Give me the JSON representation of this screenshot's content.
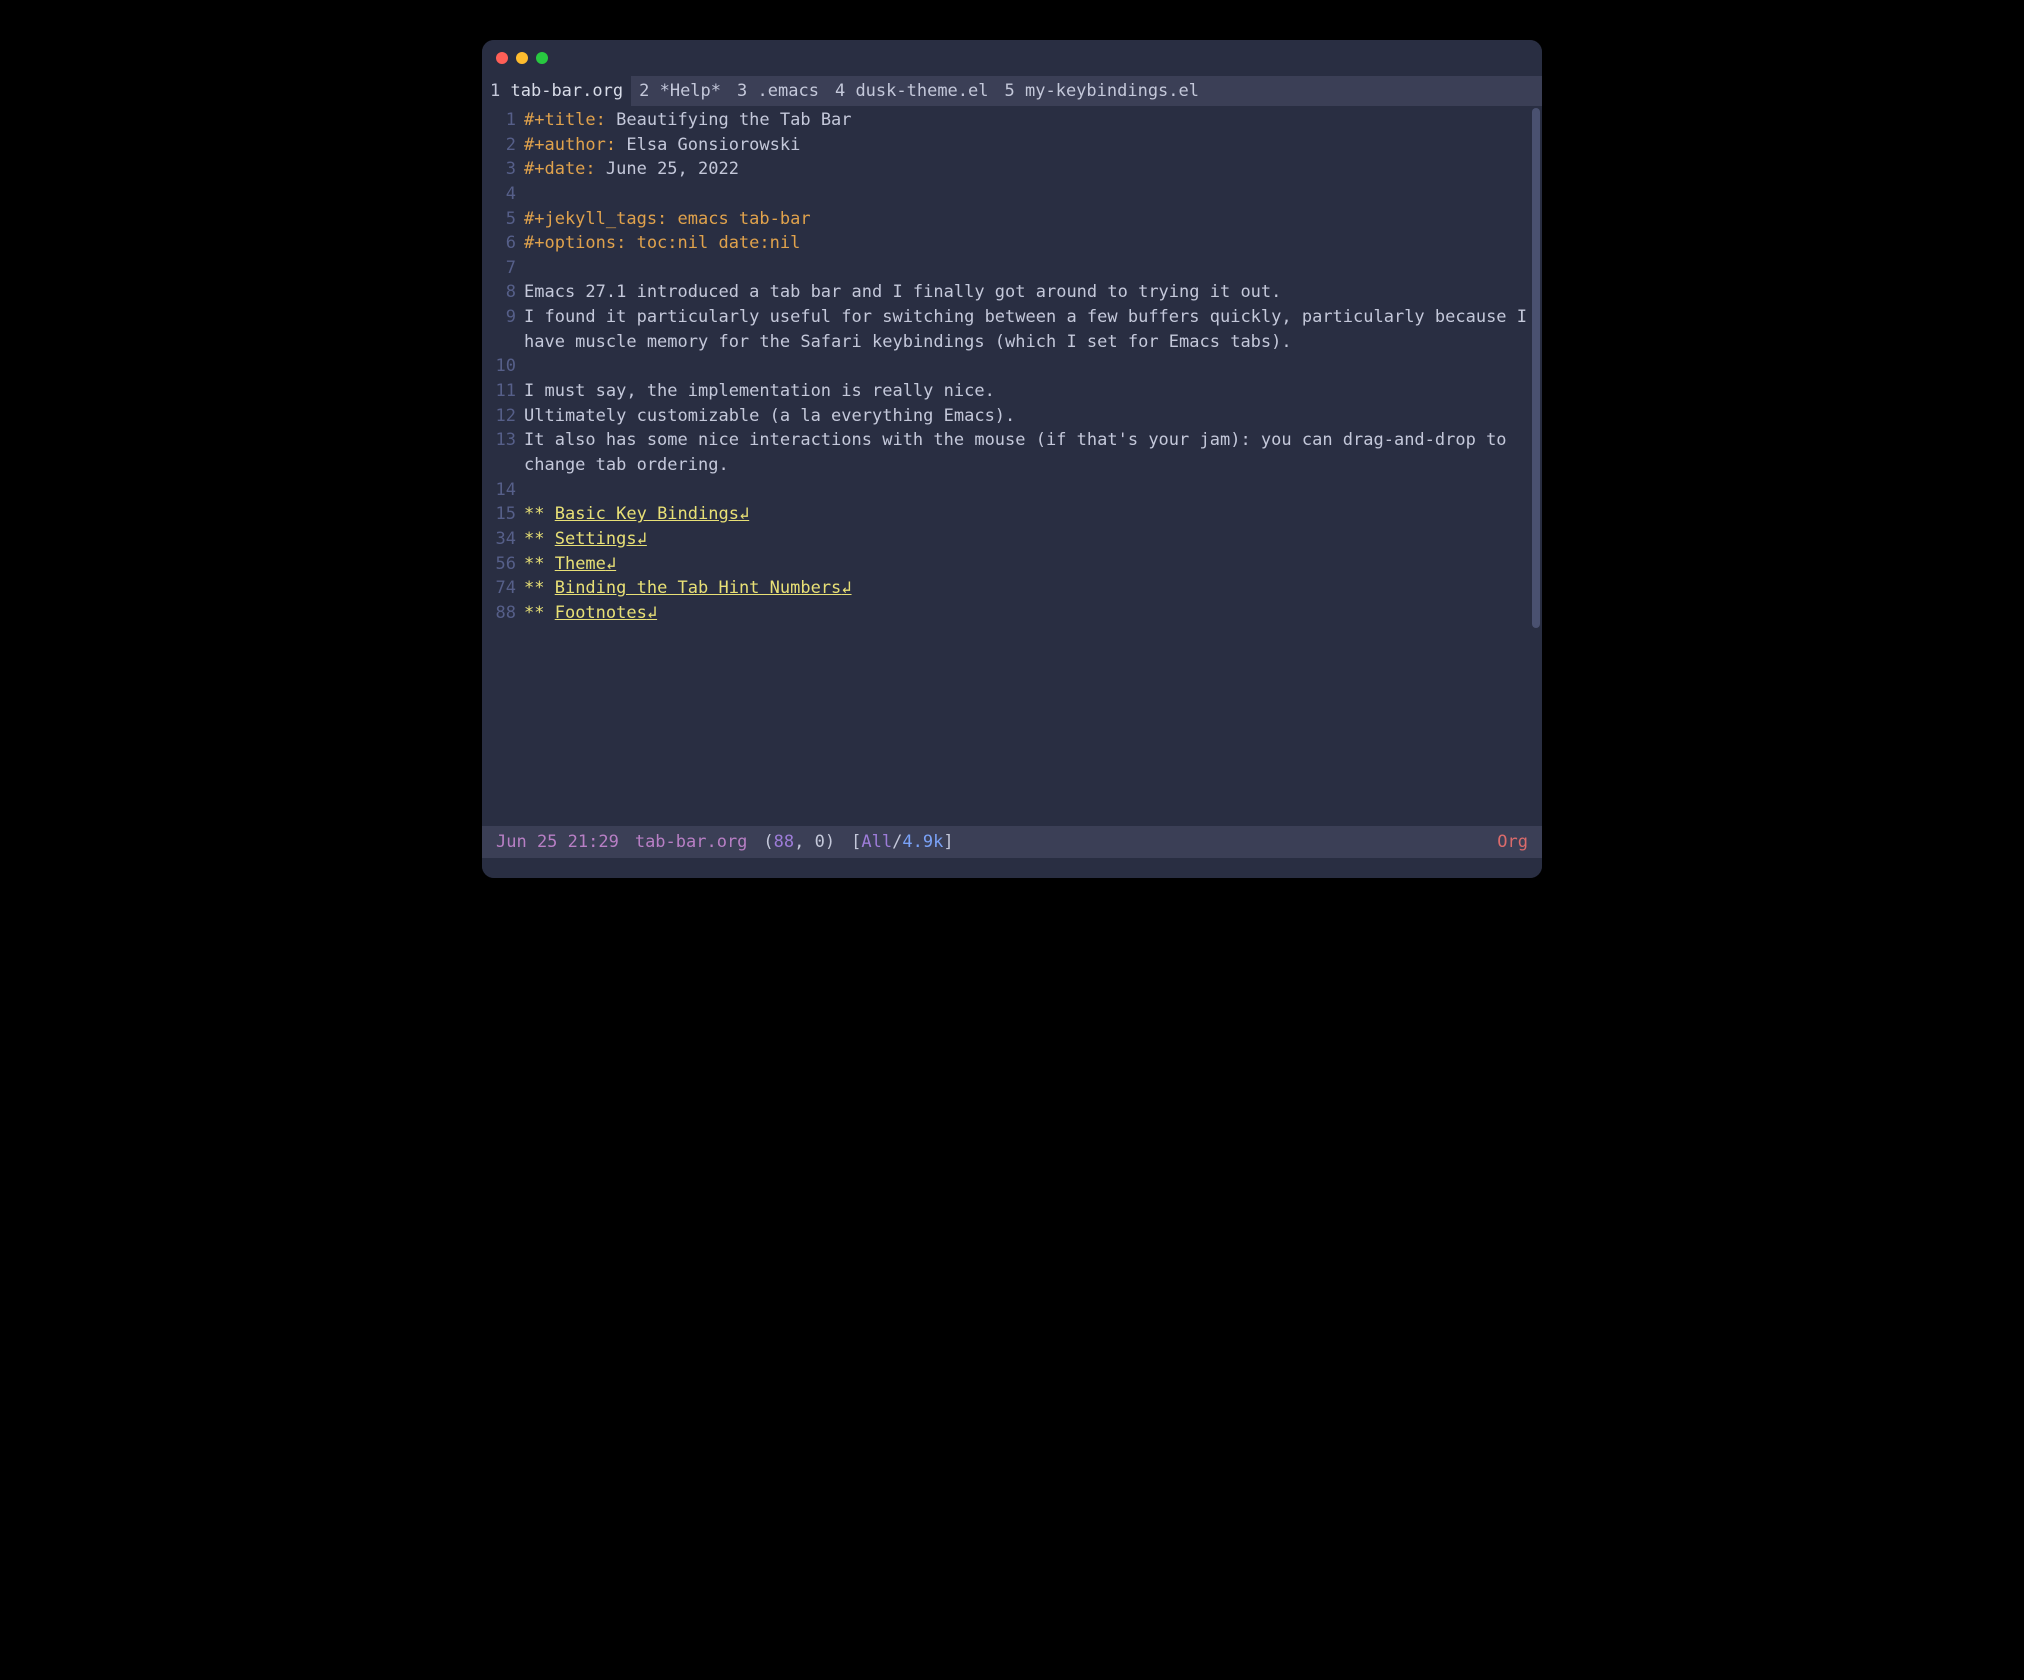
{
  "tabs": [
    {
      "num": "1",
      "label": "tab-bar.org",
      "active": true
    },
    {
      "num": "2",
      "label": "*Help*",
      "active": false
    },
    {
      "num": "3",
      "label": ".emacs",
      "active": false
    },
    {
      "num": "4",
      "label": "dusk-theme.el",
      "active": false
    },
    {
      "num": "5",
      "label": "my-keybindings.el",
      "active": false
    }
  ],
  "content": {
    "l1_kw": "#+title: ",
    "l1_txt": "Beautifying the Tab Bar",
    "l2_kw": "#+author: ",
    "l2_txt": "Elsa Gonsiorowski",
    "l3_kw": "#+date: ",
    "l3_txt": "June 25, 2022",
    "l5": "#+jekyll_tags: emacs tab-bar",
    "l6": "#+options: toc:nil date:nil",
    "l8": "Emacs 27.1 introduced a tab bar and I finally got around to trying it out.",
    "l9": "I found it particularly useful for switching between a few buffers quickly, particularly because I have muscle memory for the Safari keybindings (which I set for Emacs tabs).",
    "l11": "I must say, the implementation is really nice.",
    "l12": "Ultimately customizable (a la everything Emacs).",
    "l13": "It also has some nice interactions with the mouse (if that's your jam): you can drag-and-drop to change tab ordering.",
    "h15_stars": "** ",
    "h15_txt": "Basic Key Bindings",
    "h34_stars": "** ",
    "h34_txt": "Settings",
    "h56_stars": "** ",
    "h56_txt": "Theme",
    "h74_stars": "** ",
    "h74_txt": "Binding the Tab Hint Numbers",
    "h88_stars": "** ",
    "h88_txt": "Footnotes",
    "fold_glyph": "↲"
  },
  "linenums": {
    "n1": "1",
    "n2": "2",
    "n3": "3",
    "n4": "4",
    "n5": "5",
    "n6": "6",
    "n7": "7",
    "n8": "8",
    "n9": "9",
    "n10": "10",
    "n11": "11",
    "n12": "12",
    "n13": "13",
    "n14": "14",
    "n15": "15",
    "n34": "34",
    "n56": "56",
    "n74": "74",
    "n88": "88"
  },
  "statusbar": {
    "date": "Jun 25 21:29",
    "file": "tab-bar.org",
    "lparen": "(",
    "line": "88",
    "comma": ", ",
    "col": "0",
    "rparen": ")",
    "lbracket": "[",
    "all": "All",
    "slash": "/",
    "size": "4.9k",
    "rbracket": "]",
    "mode": "Org"
  }
}
